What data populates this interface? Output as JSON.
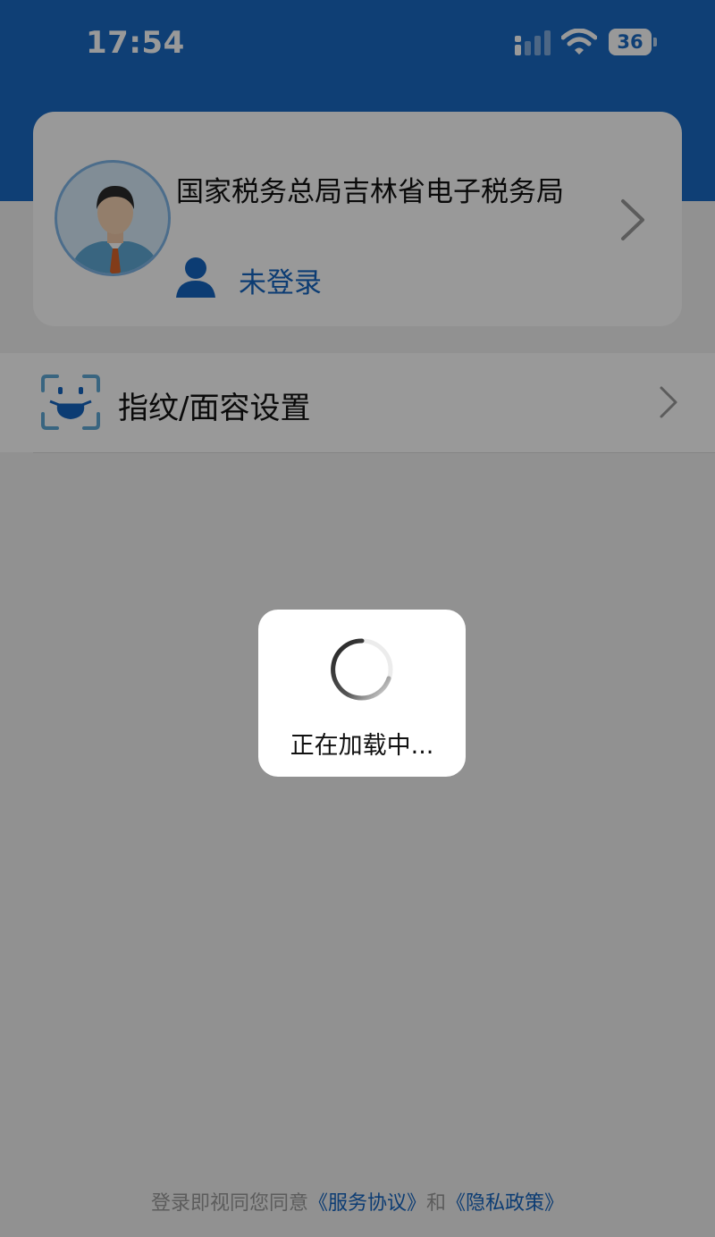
{
  "status_bar": {
    "time": "17:54",
    "battery_level": "36",
    "signal_icon": "cellular-signal-icon",
    "wifi_icon": "wifi-icon"
  },
  "colors": {
    "header_blue": "#1969c3",
    "link_blue": "#1565c0",
    "dim_overlay": "rgba(0,0,0,0.40)"
  },
  "profile_card": {
    "org_name": "国家税务总局吉林省电子税务局",
    "login_status": "未登录",
    "avatar_icon": "avatar-man-icon",
    "user_icon": "user-icon",
    "chevron_icon": "chevron-right-icon"
  },
  "menu": {
    "items": [
      {
        "label": "指纹/面容设置",
        "icon": "face-id-mask-icon"
      }
    ]
  },
  "loading": {
    "text": "正在加载中..."
  },
  "footer": {
    "prefix": "登录即视同您同意",
    "service_agreement": "《服务协议》",
    "conjunction": "和",
    "privacy_policy": "《隐私政策》"
  }
}
